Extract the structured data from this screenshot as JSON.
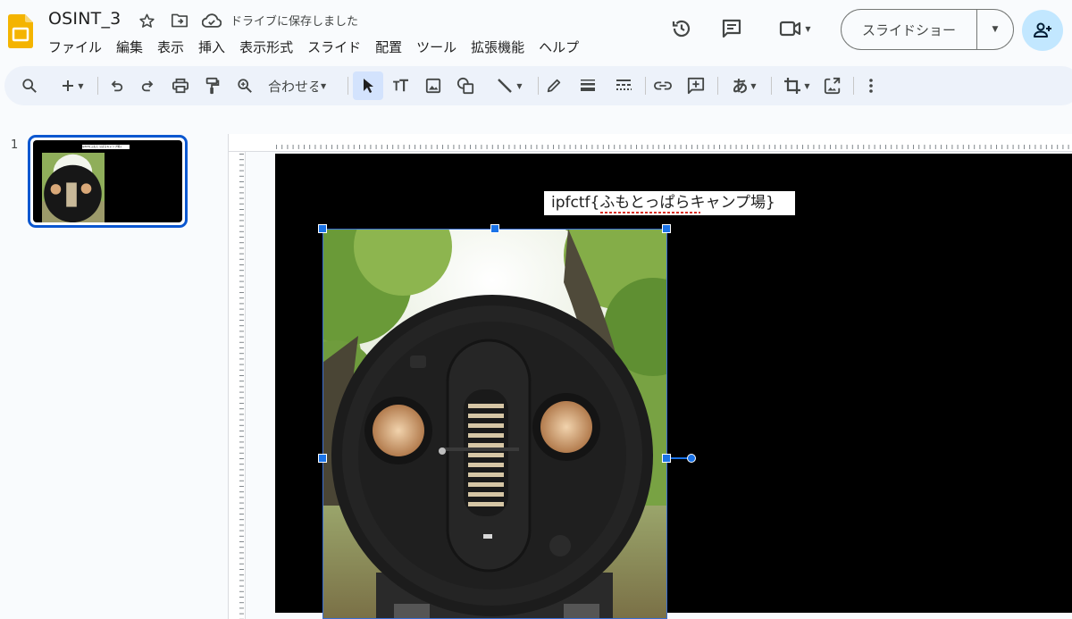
{
  "app": {
    "doc_title": "OSINT_3",
    "save_status": "ドライブに保存しました"
  },
  "menu": [
    "ファイル",
    "編集",
    "表示",
    "挿入",
    "表示形式",
    "スライド",
    "配置",
    "ツール",
    "拡張機能",
    "ヘルプ"
  ],
  "header": {
    "slideshow_label": "スライドショー",
    "icons": [
      "star-icon",
      "move-to-folder-icon",
      "cloud-saved-icon",
      "history-icon",
      "comment-icon",
      "meet-icon",
      "add-person-icon"
    ]
  },
  "toolbar": {
    "zoom_label": "合わせる",
    "tools": [
      "search-menus",
      "new-slide",
      "undo",
      "redo",
      "print",
      "paint-format",
      "zoom",
      "zoom-select",
      "select",
      "text-box",
      "image",
      "shape",
      "line",
      "pen",
      "border-weight",
      "border-dash",
      "link",
      "comment",
      "input-tools",
      "crop",
      "replace-image",
      "more"
    ],
    "input_tool_label": "あ"
  },
  "filmstrip": {
    "slides": [
      {
        "number": "1"
      }
    ]
  },
  "slide": {
    "caption": "ipfctf{ふもとっぱらキャンプ場}"
  },
  "colors": {
    "accent": "#0b57d0",
    "selection": "#1a73e8",
    "toolbar_bg": "#edf2fa",
    "share_bg": "#c2e7ff",
    "slide_bg": "#000000",
    "logo": "#f4b400"
  }
}
